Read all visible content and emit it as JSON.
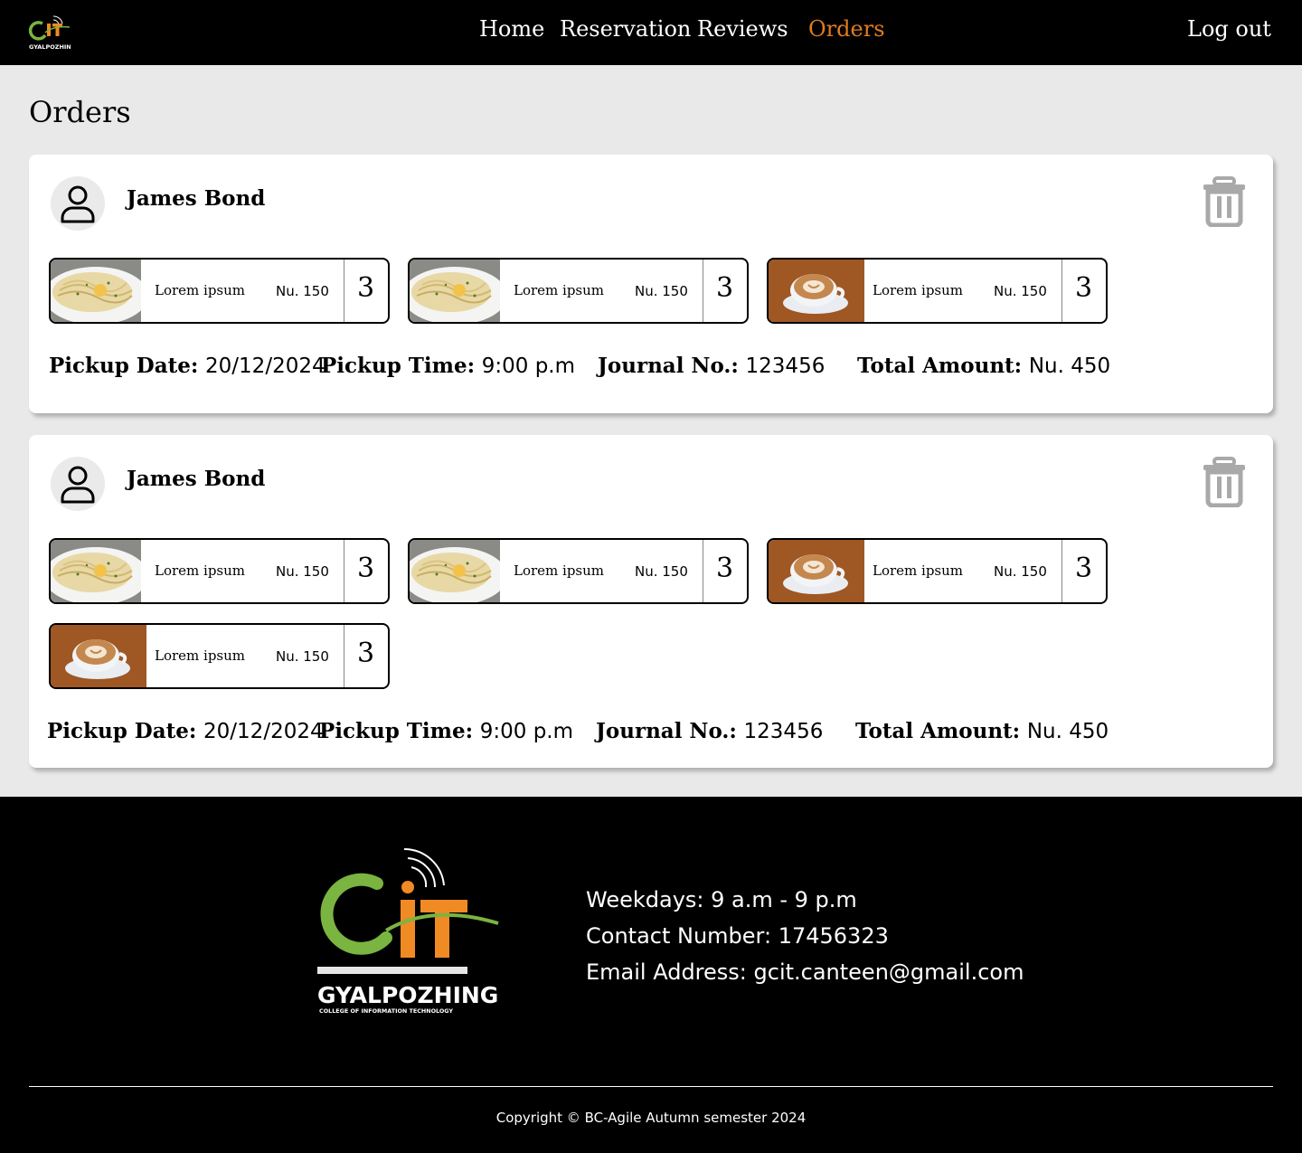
{
  "nav": {
    "logo_text": "GYALPOZHING",
    "links": [
      "Home",
      "Reservation",
      "Reviews",
      "Orders"
    ],
    "active": "Orders",
    "logout": "Log out",
    "active_color": "#e07b22"
  },
  "page": {
    "title": "Orders"
  },
  "orders": [
    {
      "customer": "James Bond",
      "items": [
        {
          "image": "pasta",
          "name": "Lorem ipsum",
          "price": "Nu. 150",
          "qty": "3"
        },
        {
          "image": "pasta",
          "name": "Lorem ipsum",
          "price": "Nu. 150",
          "qty": "3"
        },
        {
          "image": "coffee",
          "name": "Lorem ipsum",
          "price": "Nu. 150",
          "qty": "3"
        }
      ],
      "pickup_date_label": "Pickup Date:",
      "pickup_date": "20/12/2024",
      "pickup_time_label": "Pickup Time:",
      "pickup_time": "9:00 p.m",
      "journal_label": "Journal No.:",
      "journal_no": "123456",
      "total_label": "Total Amount:",
      "total": "Nu. 450"
    },
    {
      "customer": "James Bond",
      "items": [
        {
          "image": "pasta",
          "name": "Lorem ipsum",
          "price": "Nu. 150",
          "qty": "3"
        },
        {
          "image": "pasta",
          "name": "Lorem ipsum",
          "price": "Nu. 150",
          "qty": "3"
        },
        {
          "image": "coffee",
          "name": "Lorem ipsum",
          "price": "Nu. 150",
          "qty": "3"
        },
        {
          "image": "coffee",
          "name": "Lorem ipsum",
          "price": "Nu. 150",
          "qty": "3"
        }
      ],
      "pickup_date_label": "Pickup Date:",
      "pickup_date": "20/12/2024",
      "pickup_time_label": "Pickup Time:",
      "pickup_time": "9:00 p.m",
      "journal_label": "Journal No.:",
      "journal_no": "123456",
      "total_label": "Total Amount:",
      "total": "Nu. 450"
    }
  ],
  "footer": {
    "logo_text": "GYALPOZHING",
    "logo_subtext": "COLLEGE OF INFORMATION TECHNOLOGY",
    "hours": "Weekdays: 9 a.m - 9 p.m",
    "contact": "Contact Number: 17456323",
    "email": "Email Address: gcit.canteen@gmail.com",
    "copyright": "Copyright © BC-Agile Autumn semester 2024"
  },
  "icons": {
    "avatar": "user-icon",
    "delete": "trash-icon"
  },
  "colors": {
    "brand_green": "#7ab441",
    "brand_orange": "#f08a24",
    "background": "#e9e9e9"
  }
}
